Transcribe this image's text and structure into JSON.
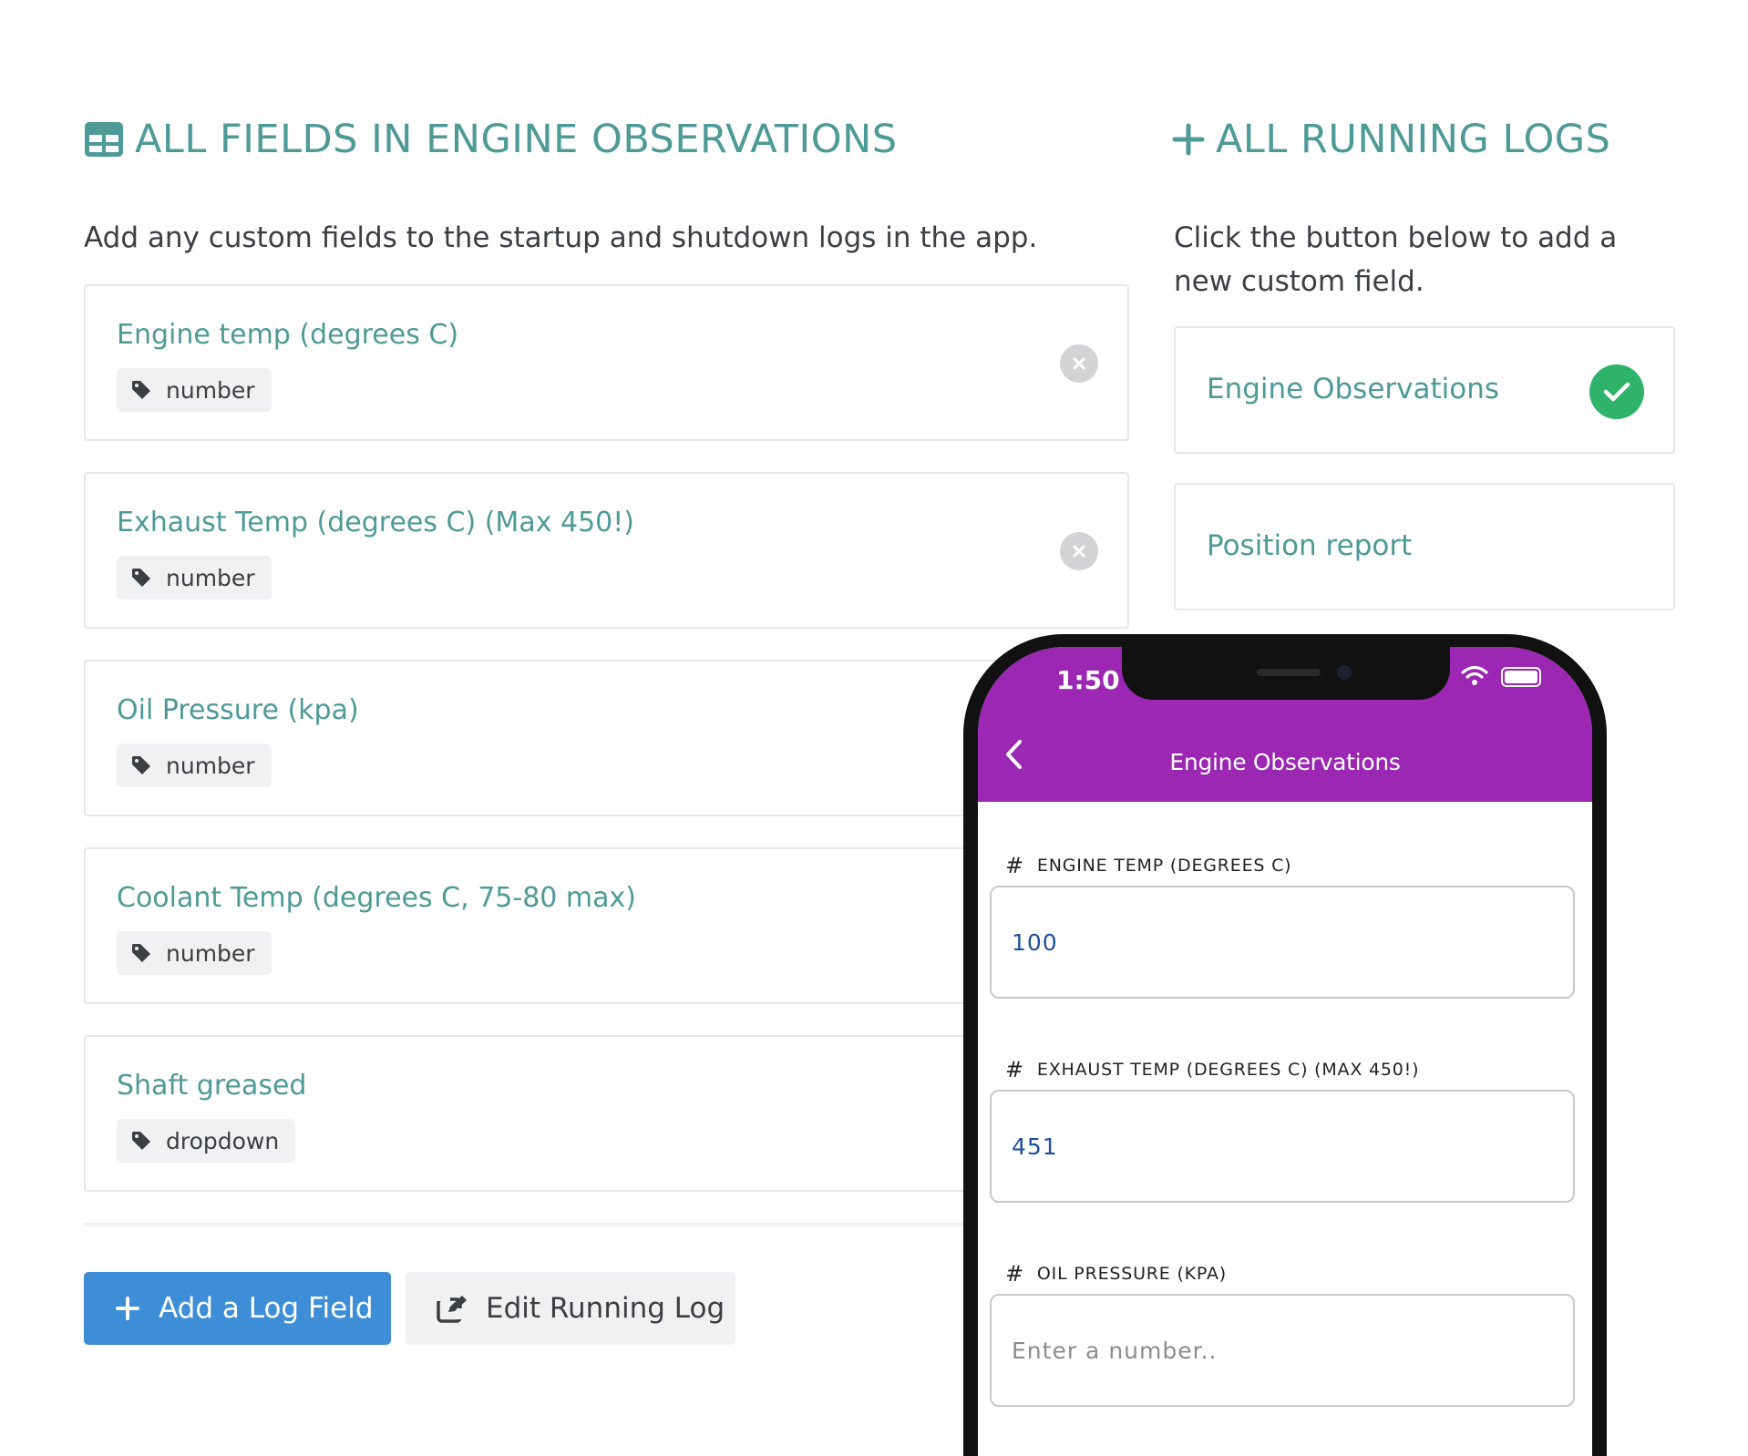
{
  "left": {
    "heading": "ALL FIELDS IN ENGINE OBSERVATIONS",
    "heading_icon": "table-icon",
    "description": "Add any custom fields to the startup and shutdown logs in the app.",
    "fields": [
      {
        "title": "Engine temp (degrees C)",
        "type": "number",
        "removable": true
      },
      {
        "title": "Exhaust Temp (degrees C) (Max 450!)",
        "type": "number",
        "removable": true
      },
      {
        "title": "Oil Pressure (kpa)",
        "type": "number"
      },
      {
        "title": "Coolant Temp (degrees C, 75-80 max)",
        "type": "number"
      },
      {
        "title": "Shaft greased",
        "type": "dropdown"
      }
    ],
    "add_button": "Add a Log Field",
    "edit_button": "Edit Running Log"
  },
  "right": {
    "heading": "ALL RUNNING LOGS",
    "heading_icon": "plus-icon",
    "description": "Click the button below to add a new custom field.",
    "logs": [
      {
        "label": "Engine Observations",
        "selected": true
      },
      {
        "label": "Position report",
        "selected": false
      }
    ]
  },
  "phone": {
    "time": "1:50",
    "title": "Engine Observations",
    "fields": [
      {
        "label": "ENGINE TEMP (DEGREES C)",
        "value": "100",
        "placeholder": ""
      },
      {
        "label": "EXHAUST TEMP (DEGREES C) (MAX 450!)",
        "value": "451",
        "placeholder": ""
      },
      {
        "label": "OIL PRESSURE (KPA)",
        "value": "",
        "placeholder": "Enter a number.."
      }
    ],
    "hash_symbol": "#"
  },
  "colors": {
    "accent_teal": "#4e9a97",
    "primary_blue": "#3d8ed7",
    "app_purple": "#9b27b3",
    "check_green": "#2fb36b"
  }
}
